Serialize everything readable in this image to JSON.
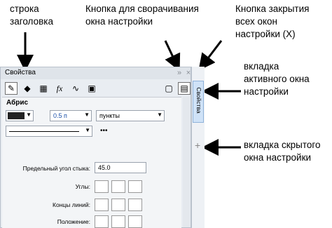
{
  "annotations": {
    "title_bar": "строка\nзаголовка",
    "collapse_button": "Кнопка для сворачивания\nокна настройки",
    "close_all": "Кнопка закрытия\nвсех окон\nнастройки (X)",
    "active_tab": "вкладка\nактивного окна\nнастройки",
    "hidden_tab": "вкладка скрытого\nокна настройки"
  },
  "window": {
    "title": "Свойства",
    "collapse_glyph": "»",
    "close_glyph": "×"
  },
  "toolbar": {
    "fx_label": "fx"
  },
  "section": {
    "title": "Абрис",
    "width_value": "0.5 п",
    "units": "пункты",
    "dash_pattern": "•••",
    "miter_label": "Предельный угол стыка:",
    "miter_value": "45.0",
    "corners_label": "Углы:",
    "caps_label": "Концы линий:",
    "position_label": "Положение:"
  },
  "side_tabs": {
    "active_label": "Свойства",
    "add_glyph": "+"
  }
}
